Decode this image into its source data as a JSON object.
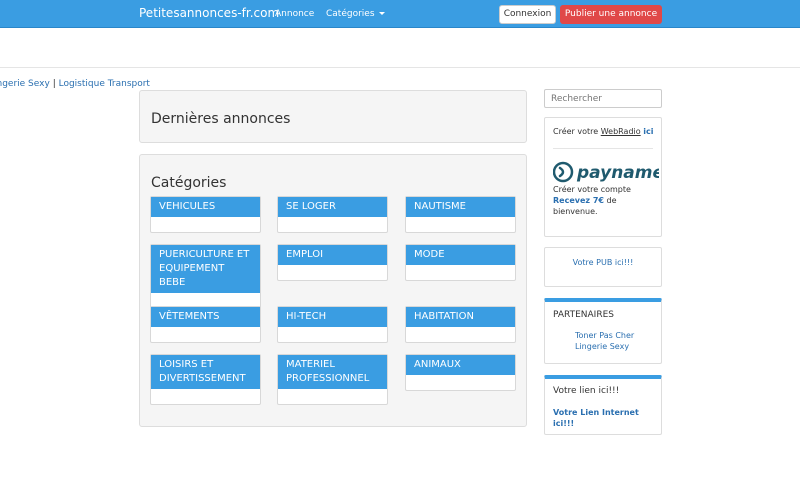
{
  "nav": {
    "brand": "Petitesannonces-fr.com",
    "annonce": "Annonce",
    "categories": "Catégories",
    "login": "Connexion",
    "publish": "Publier une annonce"
  },
  "top_links": {
    "link1": "ingerie Sexy",
    "sep": "|",
    "link2": "Logistique Transport"
  },
  "latest": {
    "title": "Dernières annonces"
  },
  "categories": {
    "title": "Catégories",
    "items": [
      "VEHICULES",
      "SE LOGER",
      "NAUTISME",
      "PUERICULTURE ET EQUIPEMENT BEBE",
      "EMPLOI",
      "MODE",
      "VÊTEMENTS",
      "HI-TECH",
      "HABITATION",
      "LOISIRS ET DIVERTISSEMENT",
      "MATERIEL PROFESSIONNEL",
      "ANIMAUX"
    ]
  },
  "sidebar": {
    "search_placeholder": "Rechercher",
    "radio": {
      "prefix": "Créer votre",
      "link": "WebRadio",
      "suffix": "ici"
    },
    "payname": {
      "logo_text": "payname",
      "line1": "Créer votre compte",
      "bold": "Recevez 7€",
      "line2": "de bienvenue."
    },
    "pub": "Votre PUB ici!!!",
    "partners": {
      "title": "PARTENAIRES",
      "links": [
        "Toner Pas Cher",
        "Lingerie Sexy"
      ]
    },
    "lien": {
      "title": "Votre lien ici!!!",
      "link": "Votre Lien Internet ici!!!"
    }
  },
  "colors": {
    "primary": "#3a9de2",
    "danger": "#e04848",
    "link": "#2a6fb0"
  }
}
